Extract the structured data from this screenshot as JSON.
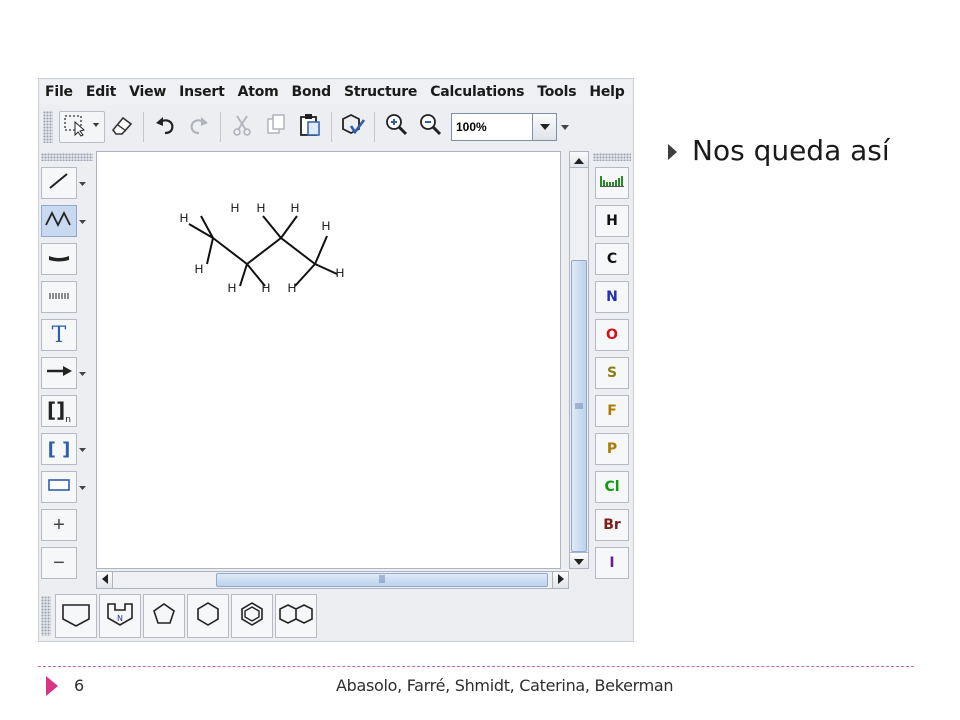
{
  "slide": {
    "bullet": "Nos queda así",
    "page_number": "6",
    "footer": "Abasolo, Farré, Shmidt, Caterina, Bekerman",
    "accent_color": "#d93585"
  },
  "menu": [
    "File",
    "Edit",
    "View",
    "Insert",
    "Atom",
    "Bond",
    "Structure",
    "Calculations",
    "Tools",
    "Help"
  ],
  "toolbar": {
    "zoom_value": "100%",
    "icons": [
      "selection-icon",
      "eraser-icon",
      "undo-icon",
      "redo-icon",
      "cut-icon",
      "copy-icon",
      "paste-icon",
      "check-structure-icon",
      "zoom-in-icon",
      "zoom-out-icon"
    ]
  },
  "left_tools": [
    {
      "name": "single-bond-icon",
      "dropdown": true
    },
    {
      "name": "chain-icon",
      "dropdown": true,
      "active": true
    },
    {
      "name": "wedge-bond-icon",
      "dropdown": false
    },
    {
      "name": "hash-bond-icon",
      "dropdown": false
    },
    {
      "name": "text-tool",
      "label": "T",
      "dropdown": false
    },
    {
      "name": "reaction-arrow-icon",
      "dropdown": true
    },
    {
      "name": "sgroup-bracket",
      "label": "[]",
      "subscript": "n",
      "dropdown": false
    },
    {
      "name": "bracket-tool",
      "label": "[ ]",
      "dropdown": true
    },
    {
      "name": "rectangle-icon",
      "dropdown": true
    },
    {
      "name": "charge-plus",
      "label": "+",
      "dropdown": false
    },
    {
      "name": "charge-minus",
      "label": "−",
      "dropdown": false
    }
  ],
  "atoms": [
    {
      "symbol": "H",
      "color": "#111111"
    },
    {
      "symbol": "C",
      "color": "#111111"
    },
    {
      "symbol": "N",
      "color": "#2430b4"
    },
    {
      "symbol": "O",
      "color": "#d3121a"
    },
    {
      "symbol": "S",
      "color": "#8a7f14"
    },
    {
      "symbol": "F",
      "color": "#b07a00"
    },
    {
      "symbol": "P",
      "color": "#b07a00"
    },
    {
      "symbol": "Cl",
      "color": "#109a10"
    },
    {
      "symbol": "Br",
      "color": "#7a1e1e"
    },
    {
      "symbol": "I",
      "color": "#6b1f8f"
    }
  ],
  "periodic_table_icon": "periodic-table-icon",
  "rings": [
    "cyclohexane-chair-icon",
    "pyrrole-n-icon",
    "cyclopentane-icon",
    "cyclohexane-icon",
    "benzene-icon",
    "naphthalene-icon"
  ],
  "molecule": {
    "name_visible": "",
    "hydrogen_label": "H"
  }
}
